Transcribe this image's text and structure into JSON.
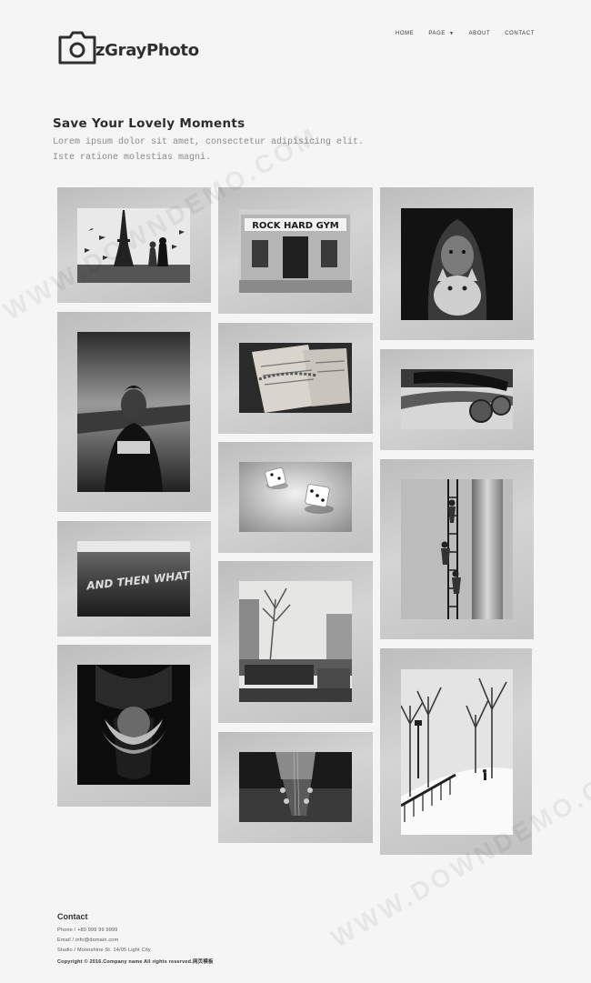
{
  "brand": {
    "name": "zGrayPhoto"
  },
  "nav": {
    "items": [
      {
        "label": "HOME"
      },
      {
        "label": "PAGE"
      },
      {
        "label": "ABOUT"
      },
      {
        "label": "CONTACT"
      }
    ]
  },
  "intro": {
    "title": "Save Your Lovely Moments",
    "line1": "Lorem ipsum dolor sit amet, consectetur adipisicing elit.",
    "line2": "Iste ratione molestias magni."
  },
  "gallery": {
    "cards": [
      {
        "icon": "eiffel-tower-doves-photo"
      },
      {
        "icon": "rock-hard-gym-photo",
        "sign": "ROCK HARD GYM"
      },
      {
        "icon": "girl-with-cat-photo"
      },
      {
        "icon": "man-on-pier-photo"
      },
      {
        "icon": "handwritten-letters-photo"
      },
      {
        "icon": "skateboard-photo"
      },
      {
        "icon": "dice-photo"
      },
      {
        "icon": "climbing-boys-photo"
      },
      {
        "icon": "graffiti-wall-photo",
        "graffiti": "AND THEN WHAT?"
      },
      {
        "icon": "city-street-furniture-photo"
      },
      {
        "icon": "hands-holding-ball-photo"
      },
      {
        "icon": "snowy-park-photo"
      },
      {
        "icon": "guitar-headstock-photo"
      }
    ]
  },
  "footer": {
    "title": "Contact",
    "phone": "Phone / +80 999 99 9999",
    "email": "Email / info@domain.com",
    "address": "Studio / Moonshine St. 14/05 Light City",
    "copyright": "Copyright © 2016.Company name All rights reserved.网页模板"
  },
  "watermark": "WWW.DOWNDEMO.COM"
}
